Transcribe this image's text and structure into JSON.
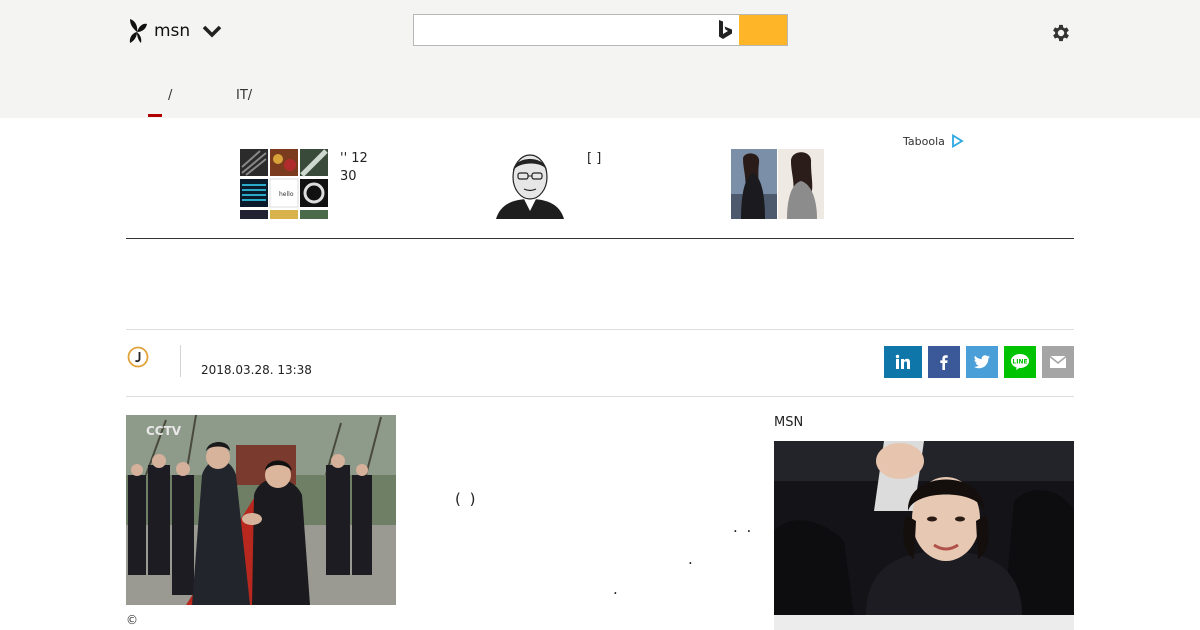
{
  "header": {
    "logo_text": "msn",
    "search_placeholder": "",
    "search_value": ""
  },
  "nav": {
    "tabs": [
      {
        "label": "/"
      },
      {
        "label": "IT/"
      }
    ]
  },
  "taboola": {
    "brand": "Taboola",
    "items": [
      {
        "line1": "''   12",
        "line2": "30"
      },
      {
        "line1": "[ ]",
        "line2": ""
      },
      {
        "line1": "",
        "line2": ""
      }
    ]
  },
  "article": {
    "date": "2018.03.28. 13:38",
    "body_fragments": [
      "(      )",
      ".   .",
      ".",
      "."
    ],
    "photo_credit": "©"
  },
  "share": {
    "buttons": [
      "linkedin",
      "facebook",
      "twitter",
      "line",
      "email"
    ],
    "colors": {
      "linkedin": "#0e76a8",
      "facebook": "#3b5998",
      "twitter": "#4a9fd8",
      "line": "#00c300",
      "email": "#a5a5a5"
    }
  },
  "sidebar": {
    "label": "MSN"
  },
  "colors": {
    "accent": "#ffb528",
    "header_bg": "#f4f4f2",
    "active_tab": "#b10000"
  }
}
